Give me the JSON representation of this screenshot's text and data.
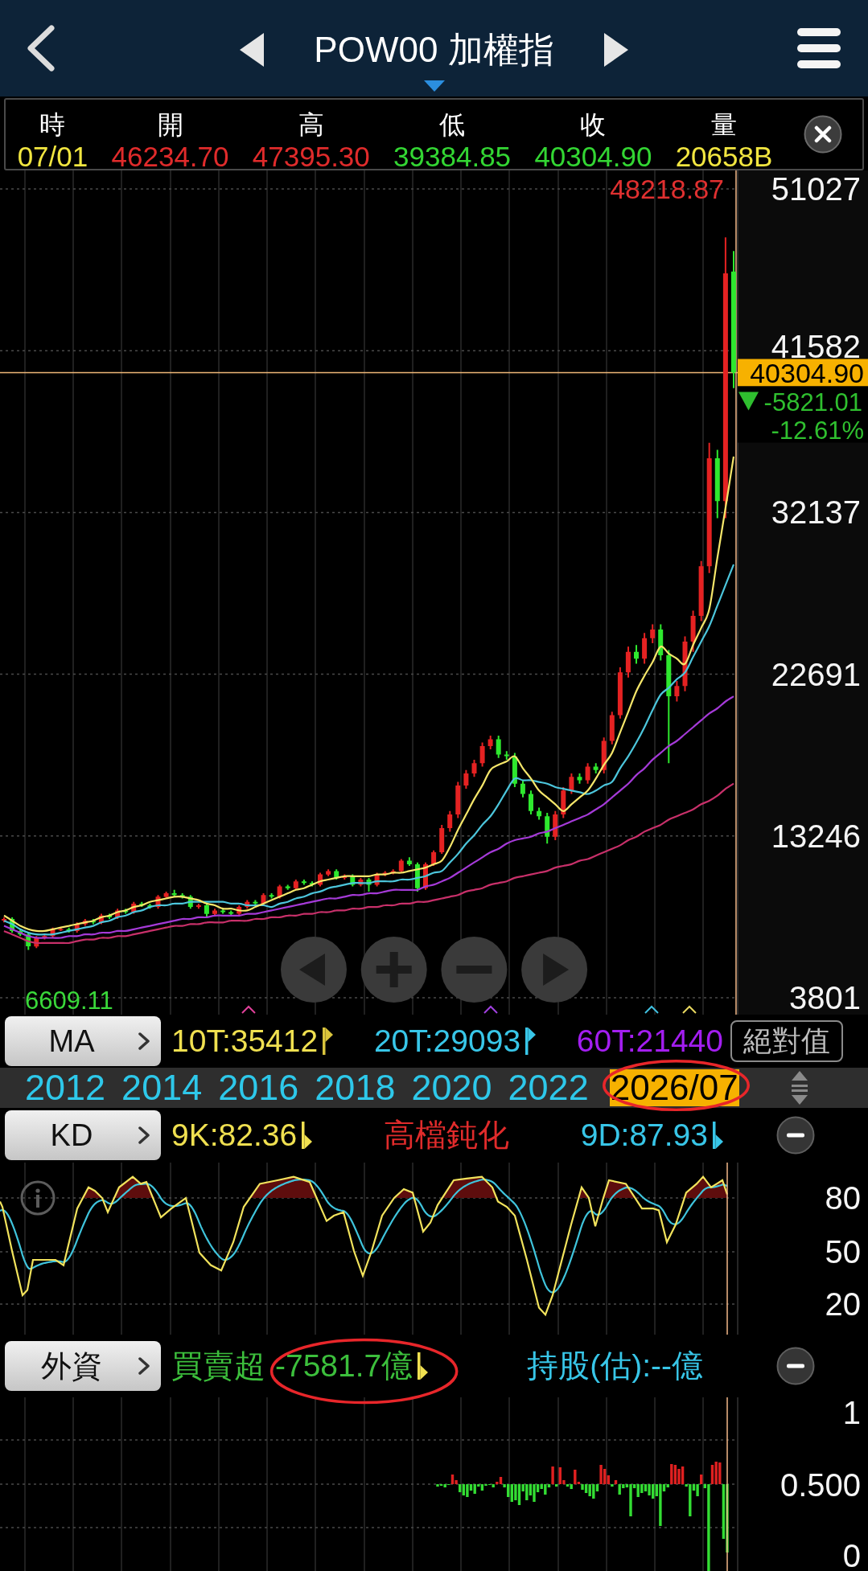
{
  "header": {
    "title": "POW00 加權指"
  },
  "quote_bar": {
    "fields": [
      {
        "label": "時",
        "value": "07/01",
        "color": "#f2e640"
      },
      {
        "label": "開",
        "value": "46234.70",
        "color": "#e02b2b"
      },
      {
        "label": "高",
        "value": "47395.30",
        "color": "#e02b2b"
      },
      {
        "label": "低",
        "value": "39384.85",
        "color": "#33d633"
      },
      {
        "label": "收",
        "value": "40304.90",
        "color": "#33d633"
      },
      {
        "label": "量",
        "value": "20658B",
        "color": "#f2e640"
      }
    ]
  },
  "price_chart": {
    "high_label": "48218.87",
    "low_label": "6609.11",
    "current_price": "40304.90",
    "change": "-5821.01",
    "change_percent": "-12.61%",
    "rising": false,
    "controls": [
      {
        "kind": "left"
      },
      {
        "kind": "zoom_in"
      },
      {
        "kind": "zoom_out"
      },
      {
        "kind": "right"
      }
    ],
    "chart_data": {
      "type": "candlestick",
      "grid": true,
      "ylim": [
        2815,
        52107
      ],
      "yticks": [
        51027,
        41582,
        32137,
        22691,
        13246,
        3801
      ],
      "ref_lines": [
        {
          "axis": "y",
          "value": 40300
        }
      ],
      "categories": [
        null,
        null,
        null,
        null,
        null,
        null,
        null,
        null,
        null,
        null,
        null,
        null,
        null,
        null,
        null,
        null,
        null,
        null,
        null,
        null,
        null,
        null,
        null,
        null,
        null,
        null,
        null,
        null,
        null,
        null,
        null,
        null,
        null,
        null,
        null,
        null,
        null,
        null,
        null,
        null,
        null,
        null,
        null,
        null,
        null,
        null,
        null,
        null,
        null,
        null,
        null,
        null,
        null,
        null,
        null,
        null,
        null,
        null,
        null,
        null,
        null,
        null,
        null,
        null,
        null,
        null,
        null,
        null,
        null,
        null,
        null,
        null,
        null,
        null,
        null,
        null,
        null,
        null,
        null,
        null,
        null,
        null,
        null,
        null,
        null,
        null,
        null,
        null,
        null,
        null,
        null
      ],
      "ohlc": [
        [
          8300,
          8500,
          8200,
          8400
        ],
        [
          8400,
          8500,
          7600,
          7700
        ],
        [
          7700,
          7800,
          7400,
          7500
        ],
        [
          7500,
          7600,
          6600,
          6800
        ],
        [
          6800,
          7400,
          6700,
          7300
        ],
        [
          7300,
          7500,
          7200,
          7400
        ],
        [
          7400,
          7900,
          7300,
          7800
        ],
        [
          7800,
          7900,
          7700,
          7800
        ],
        [
          7800,
          7900,
          7600,
          7700
        ],
        [
          7700,
          8200,
          7600,
          8100
        ],
        [
          8100,
          8400,
          8000,
          8300
        ],
        [
          8300,
          8400,
          8100,
          8200
        ],
        [
          8200,
          8700,
          8100,
          8600
        ],
        [
          8600,
          8700,
          8400,
          8500
        ],
        [
          8500,
          9000,
          8400,
          8900
        ],
        [
          8900,
          9000,
          8700,
          8800
        ],
        [
          8800,
          9400,
          8700,
          9300
        ],
        [
          9300,
          9400,
          9100,
          9200
        ],
        [
          9200,
          9300,
          9000,
          9100
        ],
        [
          9100,
          9800,
          9000,
          9700
        ],
        [
          9700,
          10000,
          9600,
          9900
        ],
        [
          9900,
          10100,
          9700,
          9800
        ],
        [
          9800,
          9900,
          9600,
          9700
        ],
        [
          9700,
          9800,
          9000,
          9100
        ],
        [
          9100,
          9300,
          9000,
          9200
        ],
        [
          9200,
          9300,
          8500,
          8700
        ],
        [
          8700,
          9000,
          8600,
          8900
        ],
        [
          8900,
          9000,
          8700,
          8800
        ],
        [
          8800,
          8900,
          8600,
          8700
        ],
        [
          8700,
          9200,
          8600,
          9100
        ],
        [
          9100,
          9500,
          9000,
          9400
        ],
        [
          9400,
          9500,
          9200,
          9300
        ],
        [
          9300,
          9900,
          9200,
          9800
        ],
        [
          9800,
          9900,
          9600,
          9700
        ],
        [
          9700,
          10400,
          9600,
          10300
        ],
        [
          10300,
          10400,
          10100,
          10200
        ],
        [
          10200,
          10700,
          10100,
          10600
        ],
        [
          10600,
          10700,
          10400,
          10500
        ],
        [
          10500,
          10600,
          10300,
          10400
        ],
        [
          10400,
          11100,
          10300,
          11000
        ],
        [
          11000,
          11300,
          10900,
          11200
        ],
        [
          11200,
          11300,
          10700,
          10800
        ],
        [
          10800,
          11000,
          10700,
          10900
        ],
        [
          10900,
          11000,
          10300,
          10400
        ],
        [
          10400,
          10800,
          10300,
          10700
        ],
        [
          10700,
          10800,
          10000,
          10400
        ],
        [
          10400,
          11100,
          10300,
          11000
        ],
        [
          11000,
          11200,
          10900,
          11100
        ],
        [
          11100,
          11300,
          11000,
          11200
        ],
        [
          11200,
          11900,
          11100,
          11800
        ],
        [
          11800,
          12000,
          11500,
          11600
        ],
        [
          11600,
          11700,
          10000,
          10200
        ],
        [
          10200,
          11700,
          10100,
          11600
        ],
        [
          11600,
          12400,
          11500,
          12300
        ],
        [
          12300,
          13900,
          12200,
          13700
        ],
        [
          13700,
          14700,
          13500,
          14500
        ],
        [
          14500,
          16400,
          14300,
          16200
        ],
        [
          16200,
          17100,
          16000,
          16900
        ],
        [
          16900,
          17700,
          16700,
          17500
        ],
        [
          17500,
          18700,
          17300,
          18500
        ],
        [
          18500,
          19100,
          18300,
          18900
        ],
        [
          18900,
          19100,
          17800,
          18000
        ],
        [
          18000,
          18200,
          17700,
          17900
        ],
        [
          17900,
          18100,
          16100,
          16300
        ],
        [
          16300,
          16500,
          15500,
          15700
        ],
        [
          15700,
          15900,
          14500,
          14700
        ],
        [
          14700,
          14900,
          14200,
          14400
        ],
        [
          14400,
          14600,
          12800,
          13200
        ],
        [
          13200,
          14700,
          13000,
          14500
        ],
        [
          14500,
          16100,
          14300,
          15900
        ],
        [
          15900,
          16900,
          15700,
          16700
        ],
        [
          16700,
          16900,
          16300,
          16500
        ],
        [
          16500,
          17500,
          16300,
          17300
        ],
        [
          17300,
          17500,
          16900,
          17100
        ],
        [
          17100,
          19000,
          16900,
          18800
        ],
        [
          18800,
          20500,
          18600,
          20300
        ],
        [
          20300,
          23100,
          20100,
          22800
        ],
        [
          22800,
          24300,
          22500,
          24000
        ],
        [
          24000,
          24400,
          23300,
          23600
        ],
        [
          23600,
          25100,
          23300,
          24800
        ],
        [
          24800,
          25600,
          24500,
          25300
        ],
        [
          25300,
          25600,
          23500,
          23800
        ],
        [
          23800,
          24100,
          17500,
          21400
        ],
        [
          21400,
          22300,
          21100,
          22000
        ],
        [
          22000,
          24900,
          21700,
          24600
        ],
        [
          24600,
          26400,
          24000,
          26100
        ],
        [
          26100,
          29300,
          25800,
          29000
        ],
        [
          29000,
          36200,
          28600,
          35300
        ],
        [
          35300,
          35800,
          31800,
          32800
        ],
        [
          32800,
          48200,
          31800,
          46100
        ],
        [
          46200,
          47400,
          39400,
          40300
        ]
      ],
      "series": [
        {
          "type": "line",
          "color": "#c8306a",
          "values": [
            7700,
            7500,
            7300,
            7100,
            7000,
            7000,
            7000,
            7000,
            7000,
            7100,
            7200,
            7200,
            7300,
            7300,
            7400,
            7400,
            7500,
            7600,
            7700,
            7800,
            7900,
            8000,
            8000,
            8100,
            8100,
            8200,
            8200,
            8200,
            8300,
            8300,
            8300,
            8400,
            8400,
            8500,
            8500,
            8600,
            8600,
            8700,
            8700,
            8800,
            8800,
            8900,
            8900,
            9000,
            9000,
            9100,
            9100,
            9200,
            9200,
            9300,
            9300,
            9400,
            9400,
            9500,
            9600,
            9700,
            9800,
            10000,
            10100,
            10200,
            10400,
            10500,
            10600,
            10800,
            10900,
            11000,
            11100,
            11200,
            11400,
            11500,
            11600,
            11800,
            11900,
            12100,
            12300,
            12500,
            12700,
            13000,
            13200,
            13500,
            13700,
            13900,
            14200,
            14400,
            14600,
            14800,
            15100,
            15300,
            15600,
            16000,
            16300
          ]
        },
        {
          "type": "line",
          "color": "#a53ad8",
          "values": [
            8000,
            7800,
            7600,
            7400,
            7300,
            7300,
            7300,
            7300,
            7400,
            7400,
            7500,
            7500,
            7600,
            7600,
            7700,
            7700,
            7800,
            7900,
            8000,
            8100,
            8200,
            8300,
            8400,
            8400,
            8500,
            8500,
            8600,
            8600,
            8600,
            8600,
            8700,
            8700,
            8800,
            8900,
            9000,
            9100,
            9200,
            9300,
            9400,
            9500,
            9600,
            9600,
            9700,
            9800,
            9800,
            9900,
            9900,
            10000,
            10100,
            10100,
            10100,
            10100,
            10300,
            10400,
            10600,
            10800,
            11100,
            11400,
            11700,
            12000,
            12300,
            12500,
            12800,
            13000,
            13100,
            13200,
            13400,
            13500,
            13700,
            13900,
            14100,
            14300,
            14500,
            14800,
            15100,
            15500,
            15900,
            16300,
            16800,
            17200,
            17700,
            18100,
            18500,
            18800,
            19200,
            19600,
            20000,
            20400,
            20700,
            21100,
            21400
          ]
        },
        {
          "type": "line",
          "color": "#4cc6dc",
          "values": [
            8300,
            8100,
            7800,
            7600,
            7500,
            7500,
            7500,
            7600,
            7700,
            7800,
            7900,
            8000,
            8200,
            8300,
            8500,
            8600,
            8800,
            8900,
            9100,
            9200,
            9200,
            9300,
            9300,
            9400,
            9400,
            9400,
            9400,
            9400,
            9300,
            9300,
            9200,
            9200,
            9200,
            9100,
            9300,
            9400,
            9600,
            9700,
            9900,
            10000,
            10200,
            10300,
            10400,
            10500,
            10500,
            10500,
            10600,
            10600,
            10600,
            10700,
            10700,
            10800,
            10900,
            11100,
            11200,
            11700,
            12200,
            12800,
            13300,
            13900,
            14400,
            15100,
            15900,
            16600,
            16500,
            16500,
            16400,
            16300,
            16100,
            16000,
            15900,
            15800,
            15700,
            15900,
            16200,
            16400,
            17200,
            17900,
            18700,
            19600,
            20600,
            21500,
            21900,
            22400,
            22800,
            23700,
            24600,
            25500,
            26700,
            27900,
            29100
          ]
        },
        {
          "type": "line",
          "color": "#f5e66a",
          "values": [
            8600,
            8300,
            8000,
            7800,
            7700,
            7700,
            7800,
            7900,
            8000,
            8100,
            8200,
            8300,
            8500,
            8600,
            8800,
            8900,
            9100,
            9200,
            9400,
            9500,
            9600,
            9700,
            9700,
            9600,
            9500,
            9300,
            9200,
            9000,
            9000,
            8900,
            8900,
            9100,
            9300,
            9500,
            9700,
            9900,
            10100,
            10200,
            10400,
            10600,
            10700,
            10800,
            10900,
            10900,
            10900,
            10900,
            11000,
            11000,
            11100,
            11100,
            11200,
            11300,
            11400,
            11600,
            11800,
            12600,
            13600,
            14500,
            15400,
            16200,
            17100,
            17400,
            17600,
            17900,
            17200,
            16600,
            15900,
            15500,
            15100,
            14700,
            15100,
            15500,
            15900,
            16600,
            17400,
            18100,
            19300,
            20500,
            21700,
            22600,
            23400,
            24300,
            23900,
            23600,
            23300,
            24400,
            25400,
            26500,
            29500,
            32400,
            35400
          ]
        }
      ]
    }
  },
  "ma_bar": {
    "button": "MA",
    "items": [
      {
        "label": "10T:35412",
        "color": "#f0e050",
        "flag": {
          "rising": true,
          "color": "#d9c43c"
        }
      },
      {
        "label": "20T:29093",
        "color": "#38c6e8",
        "flag": {
          "rising": true,
          "color": "#38c6e8"
        }
      },
      {
        "label": "60T:21440",
        "color": "#a31ef0"
      }
    ],
    "mode_button": "絕對值"
  },
  "timeline": {
    "years": [
      "2012",
      "2014",
      "2016",
      "2018",
      "2020",
      "2022"
    ],
    "current": {
      "label": "2026/07",
      "circled": true
    }
  },
  "kd": {
    "button": "KD",
    "k": {
      "label": "9K:82.36",
      "color": "#f0e050",
      "flag": {
        "rising": false,
        "color": "#f0e050"
      }
    },
    "status": {
      "label": "高檔鈍化",
      "color": "#e02b2b"
    },
    "d": {
      "label": "9D:87.93",
      "color": "#38c6e8",
      "flag": {
        "rising": false,
        "color": "#38c6e8"
      }
    },
    "y_axis_labels": [
      "80",
      "50",
      "20"
    ]
  },
  "foreign": {
    "button": "外資",
    "caption": {
      "label": "買賣超",
      "color": "#3cbf3c"
    },
    "net": {
      "label": "-7581.7億",
      "color": "#3cbf3c",
      "flag": {
        "rising": false,
        "color": "#f0e050"
      },
      "circled": true
    },
    "holdings": {
      "label": "持股(估):--億",
      "color": "#38c6e8"
    },
    "y_axis_labels": [
      "1",
      "0.500",
      "0"
    ]
  }
}
